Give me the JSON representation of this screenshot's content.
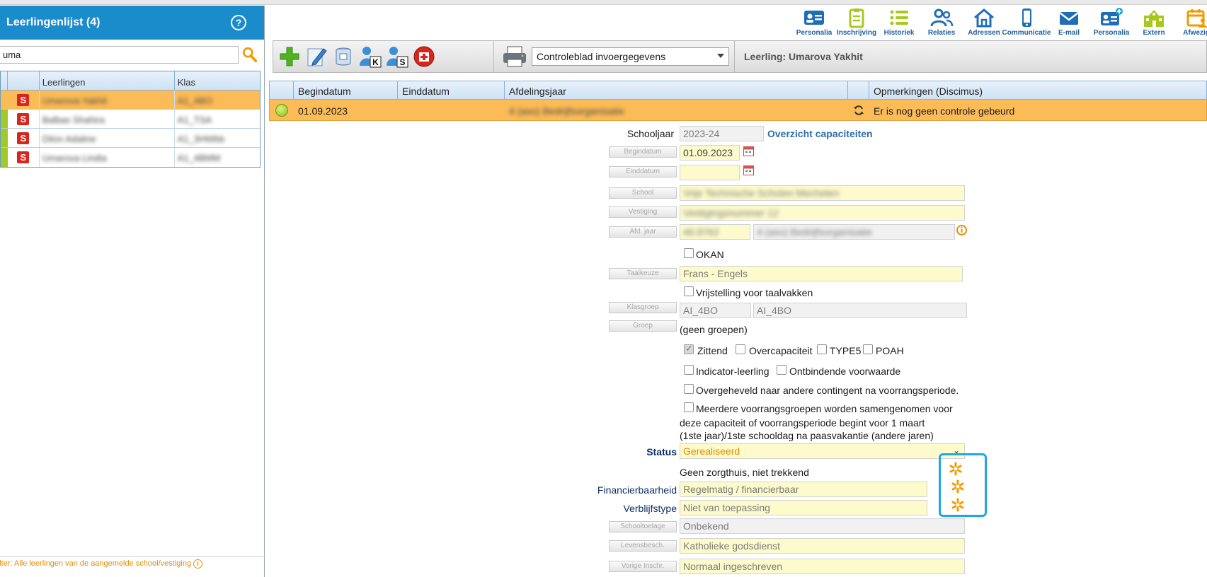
{
  "sidebar": {
    "title": "Leerlingenlijst (4)",
    "help_symbol": "?",
    "search_value": "uma",
    "columns": [
      "Leerlingen",
      "Klas"
    ],
    "rows": [
      {
        "badge": "S",
        "name": "Umarova Yakhit",
        "klas": "A1_4BO"
      },
      {
        "badge": "S",
        "name": "Balbas Shahira",
        "klas": "A1_TSA"
      },
      {
        "badge": "S",
        "name": "Dilon Adaline",
        "klas": "A1_3HWbb"
      },
      {
        "badge": "S",
        "name": "Umarova Lindia",
        "klas": "A1_4BMM"
      }
    ],
    "footer": "Filter: Alle leerlingen van de aangemelde school/vestiging",
    "footer_info_symbol": "i"
  },
  "nav": {
    "items": [
      {
        "label": "Personalia",
        "icon": "id-card-icon"
      },
      {
        "label": "Inschrijving",
        "icon": "clipboard-icon"
      },
      {
        "label": "Historiek",
        "icon": "list-icon"
      },
      {
        "label": "Relaties",
        "icon": "people-icon"
      },
      {
        "label": "Adressen",
        "icon": "house-icon"
      },
      {
        "label": "Communicatie",
        "icon": "phone-icon"
      },
      {
        "label": "E-mail",
        "icon": "envelope-icon"
      },
      {
        "label": "Personalia",
        "icon": "id-card-plus-icon"
      },
      {
        "label": "Extern",
        "icon": "school-building-icon"
      },
      {
        "label": "Afwezig",
        "icon": "calendar-person-icon"
      }
    ]
  },
  "toolbar": {
    "print_selection": "Controleblad invoergegevens",
    "student_label": "Leerling: Umarova Yakhit",
    "k_label": "K",
    "s_label": "S"
  },
  "table": {
    "columns": [
      "Begindatum",
      "Einddatum",
      "Afdelingsjaar",
      "Opmerkingen (Discimus)"
    ],
    "row": {
      "begindatum": "01.09.2023",
      "einddatum": "",
      "afdelingsjaar": "4 (aso) Bedrijfsorganisatie",
      "opmerking": "Er is nog geen controle gebeurd"
    }
  },
  "form": {
    "schooljaar_label": "Schooljaar",
    "schooljaar_value": "2023-24",
    "overzicht_link": "Overzicht capaciteiten",
    "begindatum_btn": "Begindatum",
    "begindatum_value": "01.09.2023",
    "einddatum_btn": "Einddatum",
    "einddatum_value": "",
    "school_btn": "School",
    "school_value": "Vrije Technische Scholen Mechelen",
    "vestiging_btn": "Vestiging",
    "vestiging_value": "Vestigingsnummer 12",
    "afdjaar_btn": "Afd. jaar",
    "afdjaar_code": "46.8762",
    "afdjaar_value": "4 (aso) Bedrijfsorganisatie",
    "okan_label": "OKAN",
    "taalkeuze_btn": "Taalkeuze",
    "taalkeuze_value": "Frans - Engels",
    "vrijstelling_label": "Vrijstelling voor taalvakken",
    "klasgroep_btn": "Klasgroep",
    "klasgroep_value1": "AI_4BO",
    "klasgroep_value2": "AI_4BO",
    "groep_btn": "Groep",
    "groep_value": "(geen groepen)",
    "zittend_label": "Zittend",
    "overcapaciteit_label": "Overcapaciteit",
    "type5_label": "TYPE5",
    "poah_label": "POAH",
    "indicator_label": "Indicator-leerling",
    "ontbindende_label": "Ontbindende voorwaarde",
    "overgeheveld_label": "Overgeheveld naar andere contingent na voorrangsperiode.",
    "meerdere_line1": "Meerdere voorrangsgroepen worden samengenomen voor",
    "meerdere_line2": "deze capaciteit of voorrangsperiode begint voor 1 maart",
    "meerdere_line3": "(1ste jaar)/1ste schooldag na paasvakantie (andere jaren)",
    "status_label": "Status",
    "status_value": "Gerealiseerd",
    "zorgthuis_text": "Geen zorgthuis, niet trekkend",
    "financierbaarheid_label": "Financierbaarheid",
    "financierbaarheid_value": "Regelmatig / financierbaar",
    "verblijfstype_label": "Verblijfstype",
    "verblijfstype_value": "Niet van toepassing",
    "schooltoelage_btn": "Schooltoelage",
    "schooltoelage_value": "Onbekend",
    "levensbesch_btn": "Levensbesch.",
    "levensbesch_value": "Katholieke godsdienst",
    "vorige_btn": "Vorige Inschr.",
    "vorige_value": "Normaal ingeschreven"
  },
  "colors": {
    "header_blue": "#1a8ccc",
    "selected_row": "#fbbb57",
    "accent_orange": "#e48d00",
    "highlight_border": "#1ea7e6"
  }
}
